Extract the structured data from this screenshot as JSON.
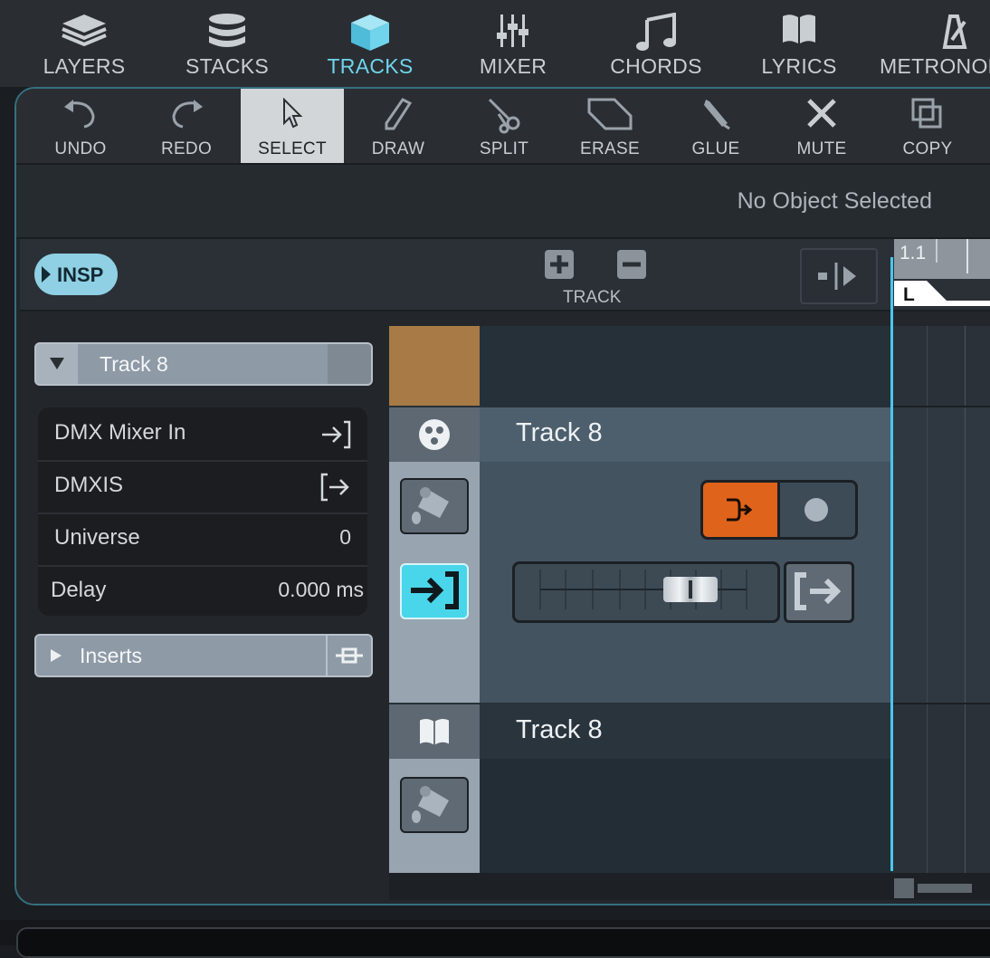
{
  "top_nav": {
    "items": [
      {
        "label": "LAYERS",
        "icon": "layers-icon"
      },
      {
        "label": "STACKS",
        "icon": "stacks-icon"
      },
      {
        "label": "TRACKS",
        "icon": "tracks-cube-icon",
        "active": true
      },
      {
        "label": "MIXER",
        "icon": "mixer-faders-icon"
      },
      {
        "label": "CHORDS",
        "icon": "music-note-icon"
      },
      {
        "label": "LYRICS",
        "icon": "book-icon"
      },
      {
        "label": "METRONOME",
        "icon": "metronome-icon"
      }
    ]
  },
  "edit_toolbar": {
    "tools": [
      {
        "label": "UNDO",
        "icon": "undo-icon"
      },
      {
        "label": "REDO",
        "icon": "redo-icon"
      },
      {
        "label": "SELECT",
        "icon": "pointer-icon",
        "active": true
      },
      {
        "label": "DRAW",
        "icon": "pencil-icon"
      },
      {
        "label": "SPLIT",
        "icon": "scissors-icon"
      },
      {
        "label": "ERASE",
        "icon": "eraser-icon"
      },
      {
        "label": "GLUE",
        "icon": "glue-icon"
      },
      {
        "label": "MUTE",
        "icon": "mute-x-icon"
      },
      {
        "label": "COPY",
        "icon": "copy-icon"
      }
    ]
  },
  "info_bar": {
    "text": "No Object Selected"
  },
  "header": {
    "insp_label": "INSP",
    "track_label": "TRACK",
    "ruler_start": "1.1",
    "loop_marker": "L"
  },
  "inspector": {
    "track_name": "Track 8",
    "rows": [
      {
        "key": "DMX Mixer In",
        "icon": "input-arrow-icon"
      },
      {
        "key": "DMXIS",
        "icon": "output-arrow-icon"
      },
      {
        "key": "Universe",
        "value": "0"
      },
      {
        "key": "Delay",
        "value": "0.000 ms"
      }
    ],
    "inserts_label": "Inserts"
  },
  "tracks": [
    {
      "name": "Track 8",
      "type": "dmx",
      "icon": "dmx-connector-icon"
    },
    {
      "name": "Track 8",
      "type": "lyrics",
      "icon": "book-icon"
    }
  ],
  "colors": {
    "accent": "#6fd4ec",
    "track_color_top": "#a87a45",
    "record_arm": "#e0631b",
    "playhead": "#49c6ee"
  }
}
